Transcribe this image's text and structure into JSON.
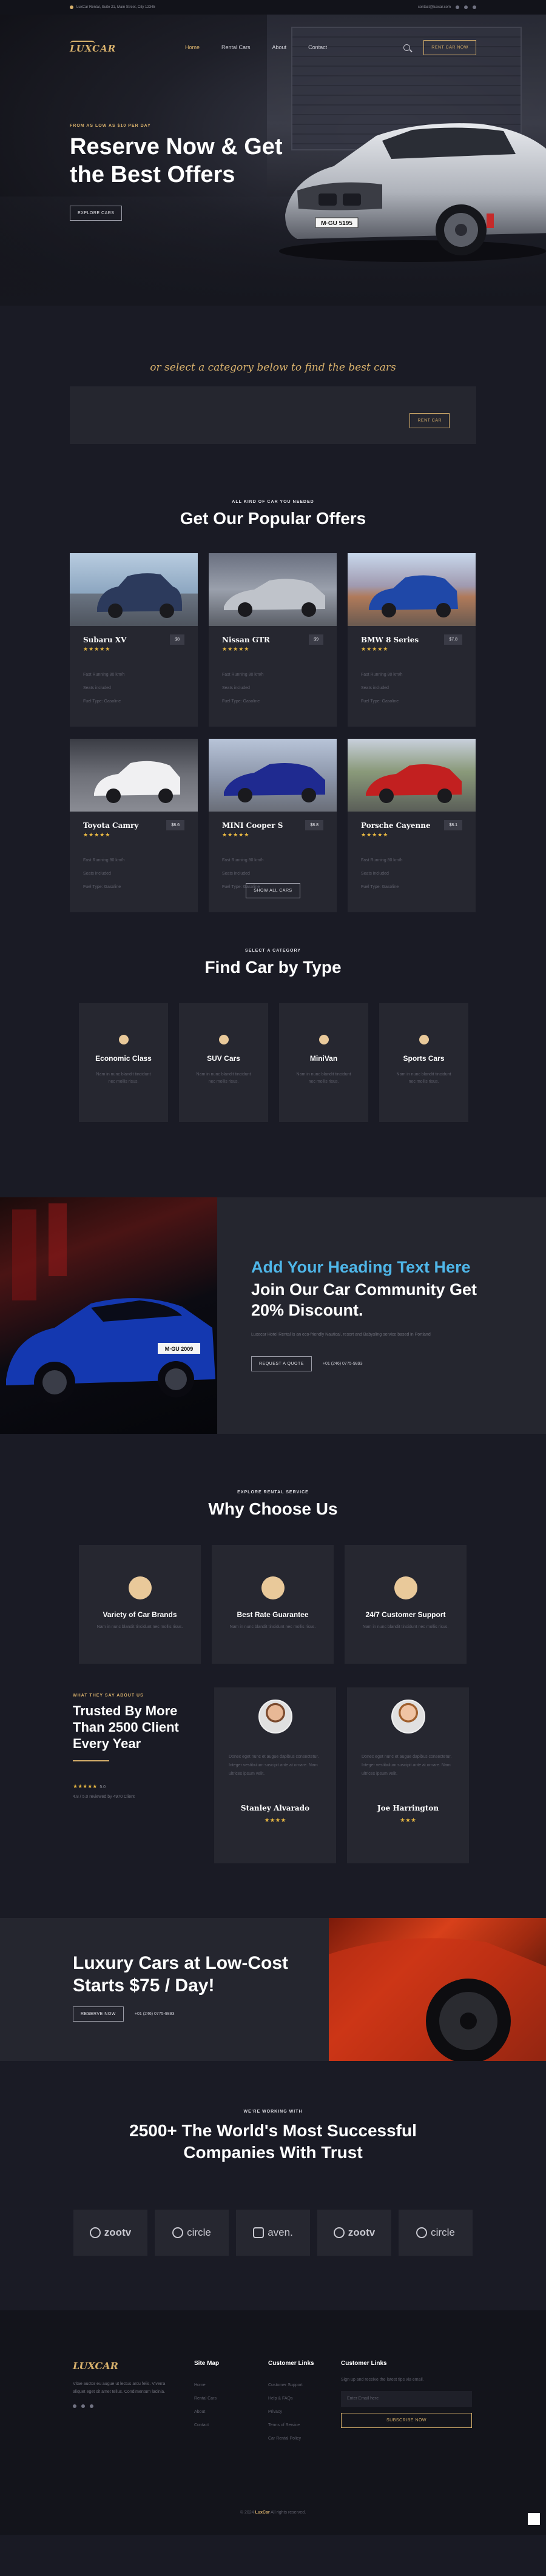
{
  "topbar": {
    "address": "LuxCar Rental, Suite 21, Main Street, City 12345",
    "email": "contact@luxcar.com"
  },
  "brand": {
    "logo": "LUXCAR"
  },
  "nav": {
    "items": [
      "Home",
      "Rental Cars",
      "About",
      "Contact"
    ],
    "cta": "RENT CAR NOW"
  },
  "hero": {
    "kicker": "FROM AS LOW AS $10 PER DAY",
    "title": "Reserve Now & Get the Best Offers",
    "button": "EXPLORE CARS",
    "plate": "M·GU 5195"
  },
  "category": {
    "script_title": "or select a category below to find the best cars",
    "button": "RENT CAR"
  },
  "offers": {
    "kicker": "ALL KIND OF CAR YOU NEEDED",
    "title": "Get Our Popular Offers",
    "cars": [
      {
        "name": "Subaru XV",
        "price": "$8",
        "specs": [
          "Fast Running 80 km/h",
          "Seats included",
          "Fuel Type: Gasoline"
        ]
      },
      {
        "name": "Nissan GTR",
        "price": "$9",
        "specs": [
          "Fast Running 80 km/h",
          "Seats included",
          "Fuel Type: Gasoline"
        ]
      },
      {
        "name": "BMW 8 Series",
        "price": "$7.8",
        "specs": [
          "Fast Running 80 km/h",
          "Seats included",
          "Fuel Type: Gasoline"
        ]
      },
      {
        "name": "Toyota Camry",
        "price": "$8.6",
        "specs": [
          "Fast Running 80 km/h",
          "Seats included",
          "Fuel Type: Gasoline"
        ]
      },
      {
        "name": "MINI Cooper S",
        "price": "$8.8",
        "specs": [
          "Fast Running 80 km/h",
          "Seats included",
          "Fuel Type: Gasoline"
        ]
      },
      {
        "name": "Porsche Cayenne",
        "price": "$8.1",
        "specs": [
          "Fast Running 80 km/h",
          "Seats included",
          "Fuel Type: Gasoline"
        ]
      }
    ],
    "show_all": "SHOW ALL CARS"
  },
  "types": {
    "kicker": "SELECT A CATEGORY",
    "title": "Find Car by Type",
    "items": [
      {
        "name": "Economic Class",
        "desc": "Nam in nunc blandit tincidunt nec mollis risus."
      },
      {
        "name": "SUV Cars",
        "desc": "Nam in nunc blandit tincidunt nec mollis risus."
      },
      {
        "name": "MiniVan",
        "desc": "Nam in nunc blandit tincidunt nec mollis risus."
      },
      {
        "name": "Sports Cars",
        "desc": "Nam in nunc blandit tincidunt nec mollis risus."
      }
    ]
  },
  "community": {
    "heading": "Add Your Heading Text Here",
    "title": "Join Our Car Community Get 20% Discount.",
    "text": "Luxecar Hotel Rental is an eco-friendly Nautical, resort and Babysling service based in Portland",
    "button": "REQUEST A QUOTE",
    "phone": "+01 (246) 0775-9893",
    "plate": "M·GU 2009"
  },
  "why": {
    "kicker": "EXPLORE RENTAL SERVICE",
    "title": "Why Choose Us",
    "items": [
      {
        "name": "Variety of Car Brands",
        "desc": "Nam in nunc blandit tincidunt nec mollis risus."
      },
      {
        "name": "Best Rate Guarantee",
        "desc": "Nam in nunc blandit tincidunt nec mollis risus."
      },
      {
        "name": "24/7 Customer Support",
        "desc": "Nam in nunc blandit tincidunt nec mollis risus."
      }
    ]
  },
  "testimonials": {
    "kicker": "WHAT THEY SAY ABOUT US",
    "title": "Trusted By More Than 2500 Client Every Year",
    "rating": "★★★★★",
    "rating_value": "5.0",
    "reviewed": "4.8 / 5.0 reviewed by 4970 Client",
    "items": [
      {
        "text": "Donec eget nunc et augue dapibus consectetur. Integer vestibulum suscipit ante at ornare. Nam ultrices ipsum velit.",
        "name": "Stanley Alvarado",
        "stars": "★★★★"
      },
      {
        "text": "Donec eget nunc et augue dapibus consectetur. Integer vestibulum suscipit ante at ornare. Nam ultrices ipsum velit.",
        "name": "Joe Harrington",
        "stars": "★★★"
      }
    ]
  },
  "banner": {
    "title": "Luxury Cars at Low-Cost Starts $75 / Day!",
    "button": "RESERVE NOW",
    "phone": "+01 (246) 0775-9893"
  },
  "partners": {
    "kicker": "WE'RE WORKING WITH",
    "title": "2500+ The World's Most Successful Companies With Trust",
    "logos": [
      "zootv",
      "circle",
      "aven.",
      "zootv",
      "circle"
    ]
  },
  "footer": {
    "logo": "LUXCAR",
    "desc": "Vitae auctor eu augue ut lectus arcu felis. Viverra aliquet eget sit amet tellus. Condimentum lacinia.",
    "cols": [
      {
        "title": "Site Map",
        "links": [
          "Home",
          "Rental Cars",
          "About",
          "Contact"
        ]
      },
      {
        "title": "Customer Links",
        "links": [
          "Customer Support",
          "Help & FAQs",
          "Privacy",
          "Terms of Service",
          "Car Rental Policy"
        ]
      }
    ],
    "newsletter_title": "Customer Links",
    "newsletter_text": "Sign up and receive the latest tips via email.",
    "email_placeholder": "Enter Email here",
    "subscribe": "SUBSCRIBE NOW",
    "copyright_prefix": "© 2024",
    "copyright_brand": "LuxCar",
    "copyright_suffix": "All rights reserved."
  }
}
